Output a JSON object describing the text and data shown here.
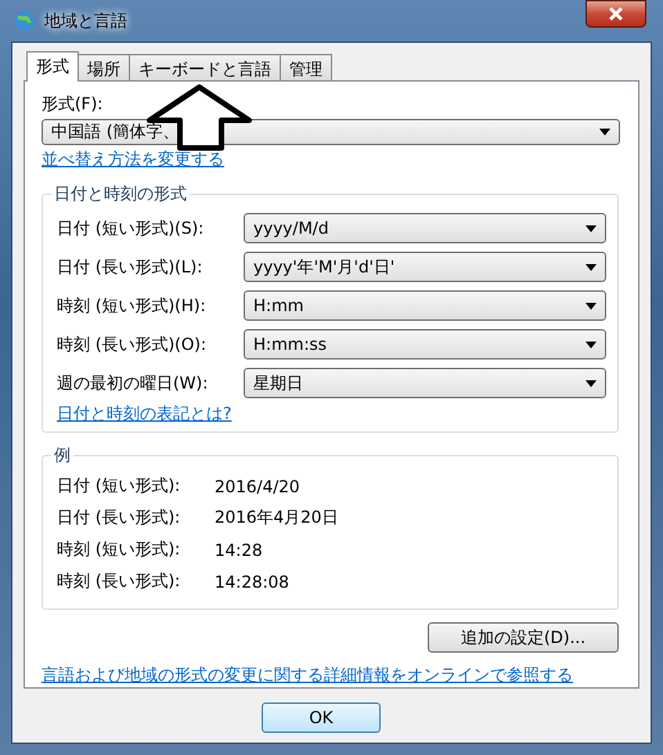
{
  "window": {
    "title": "地域と言語"
  },
  "tabs": [
    {
      "label": "形式",
      "selected": true
    },
    {
      "label": "場所",
      "selected": false
    },
    {
      "label": "キーボードと言語",
      "selected": false
    },
    {
      "label": "管理",
      "selected": false
    }
  ],
  "format": {
    "label": "形式(F):",
    "value": "中国語 (簡体字、"
  },
  "sort_link": "並べ替え方法を変更する",
  "date_time_group": {
    "title": "日付と時刻の形式",
    "rows": [
      {
        "label": "日付 (短い形式)(S):",
        "value": "yyyy/M/d"
      },
      {
        "label": "日付 (長い形式)(L):",
        "value": "yyyy'年'M'月'd'日'"
      },
      {
        "label": "時刻 (短い形式)(H):",
        "value": "H:mm"
      },
      {
        "label": "時刻 (長い形式)(O):",
        "value": "H:mm:ss"
      },
      {
        "label": "週の最初の曜日(W):",
        "value": "星期日"
      }
    ],
    "link": "日付と時刻の表記とは?"
  },
  "examples_group": {
    "title": "例",
    "rows": [
      {
        "label": "日付 (短い形式):",
        "value": "2016/4/20"
      },
      {
        "label": "日付 (長い形式):",
        "value": "2016年4月20日"
      },
      {
        "label": "時刻 (短い形式):",
        "value": "14:28"
      },
      {
        "label": "時刻 (長い形式):",
        "value": "14:28:08"
      }
    ]
  },
  "additional_button": "追加の設定(D)...",
  "online_link": "言語および地域の形式の変更に関する詳細情報をオンラインで参照する",
  "buttons": [
    "OK"
  ]
}
